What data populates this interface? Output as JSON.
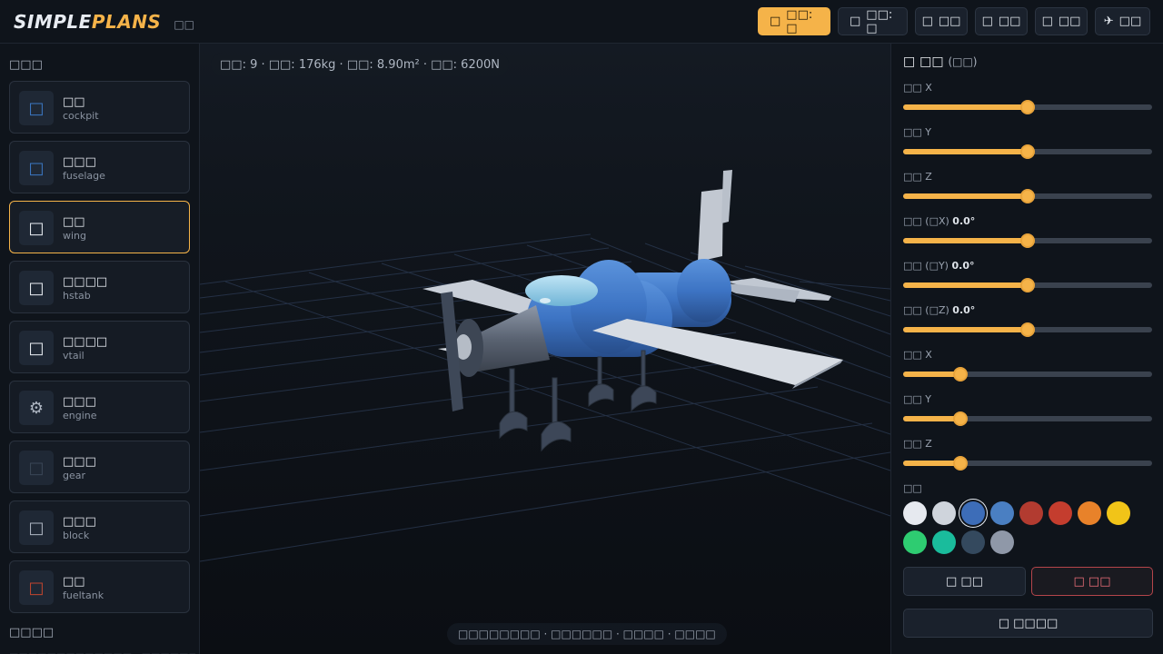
{
  "header": {
    "logo_a": "SIMPLE",
    "logo_b": "PLANS",
    "subtitle": "□□",
    "buttons": [
      {
        "icon": "□",
        "label": "□□: □",
        "primary": true
      },
      {
        "icon": "□",
        "label": "□□: □",
        "primary": false
      },
      {
        "icon": "□",
        "label": "□□",
        "primary": false
      },
      {
        "icon": "□",
        "label": "□□",
        "primary": false
      },
      {
        "icon": "□",
        "label": "□□",
        "primary": false
      },
      {
        "icon": "✈",
        "label": "□□",
        "primary": false
      }
    ]
  },
  "left": {
    "parts_title": "□□□",
    "parts": [
      {
        "name": "□□",
        "id": "cockpit",
        "icon": "□",
        "icon_color": "#3b78c4",
        "selected": false
      },
      {
        "name": "□□□",
        "id": "fuselage",
        "icon": "□",
        "icon_color": "#3b78c4",
        "selected": false
      },
      {
        "name": "□□",
        "id": "wing",
        "icon": "□",
        "icon_color": "#e8ecf2",
        "selected": true
      },
      {
        "name": "□□□□",
        "id": "hstab",
        "icon": "□",
        "icon_color": "#e8ecf2",
        "selected": false
      },
      {
        "name": "□□□□",
        "id": "vtail",
        "icon": "□",
        "icon_color": "#e8ecf2",
        "selected": false
      },
      {
        "name": "□□□",
        "id": "engine",
        "icon": "⚙",
        "icon_color": "#aeb6c2",
        "selected": false
      },
      {
        "name": "□□□",
        "id": "gear",
        "icon": "□",
        "icon_color": "#3a4656",
        "selected": false
      },
      {
        "name": "□□□",
        "id": "block",
        "icon": "□",
        "icon_color": "#aeb6c2",
        "selected": false
      },
      {
        "name": "□□",
        "id": "fueltank",
        "icon": "□",
        "icon_color": "#c0452f",
        "selected": false
      }
    ],
    "tips_title": "□□□□",
    "tips_text": "□□□□□□□□□□□□□ · □□□□□□□□□□□□ · □□"
  },
  "viewport": {
    "stats": "□□: 9 · □□: 176kg · □□: 8.90m² · □□: 6200N",
    "hint": "□□□□□□□□ · □□□□□□ · □□□□ · □□□□"
  },
  "panel": {
    "title": "□ □□",
    "title_sub": "(□□)",
    "sliders": [
      {
        "label": "□□ X",
        "value": "",
        "fraction": 0.5
      },
      {
        "label": "□□ Y",
        "value": "",
        "fraction": 0.5
      },
      {
        "label": "□□ Z",
        "value": "",
        "fraction": 0.5
      },
      {
        "label": "□□ (□X)",
        "value": "0.0°",
        "fraction": 0.5
      },
      {
        "label": "□□ (□Y)",
        "value": "0.0°",
        "fraction": 0.5
      },
      {
        "label": "□□ (□Z)",
        "value": "0.0°",
        "fraction": 0.5
      },
      {
        "label": "□□ X",
        "value": "",
        "fraction": 0.23
      },
      {
        "label": "□□ Y",
        "value": "",
        "fraction": 0.23
      },
      {
        "label": "□□ Z",
        "value": "",
        "fraction": 0.23
      }
    ],
    "color_label": "□□",
    "colors": [
      "#e6e9ef",
      "#cfd4dc",
      "#3d6db8",
      "#4a7fc2",
      "#b23b30",
      "#c43d2e",
      "#e8822a",
      "#f1c418",
      "#2ecc71",
      "#1abc9c",
      "#34495e",
      "#8f98a8"
    ],
    "selected_color": 2,
    "copy_label": "□ □□",
    "delete_label": "□ □□",
    "deselect_label": "□ □□□□"
  },
  "colors": {
    "accent": "#f5b349",
    "danger": "#f0707a",
    "background": "#0c1016"
  }
}
